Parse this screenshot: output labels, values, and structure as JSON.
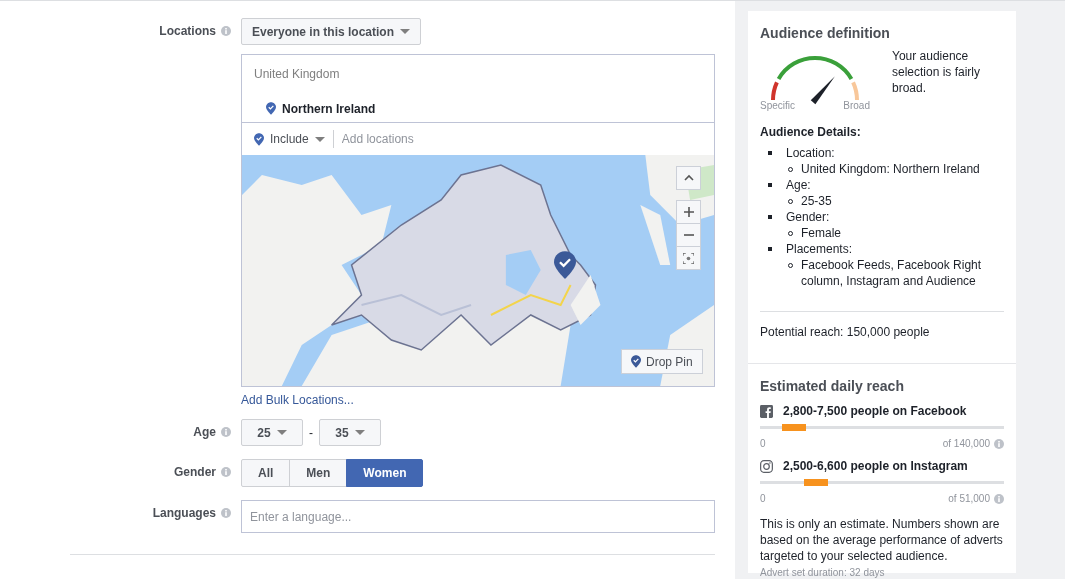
{
  "form": {
    "locations": {
      "label": "Locations",
      "mode": "Everyone in this location",
      "country": "United Kingdom",
      "selected_location": "Northern Ireland",
      "include": "Include",
      "add_placeholder": "Add locations",
      "map": {
        "kind": "picture",
        "drop_pin": "Drop Pin"
      },
      "bulk_link": "Add Bulk Locations..."
    },
    "age": {
      "label": "Age",
      "min": "25",
      "separator": "-",
      "max": "35"
    },
    "gender": {
      "label": "Gender",
      "options": [
        {
          "label": "All",
          "selected": false
        },
        {
          "label": "Men",
          "selected": false
        },
        {
          "label": "Women",
          "selected": true
        }
      ]
    },
    "languages": {
      "label": "Languages",
      "placeholder": "Enter a language..."
    }
  },
  "audience_definition": {
    "title": "Audience definition",
    "gauge": {
      "low_label": "Specific",
      "high_label": "Broad"
    },
    "summary": "Your audience selection is fairly broad.",
    "details_title": "Audience Details:",
    "details": [
      {
        "label": "Location:",
        "values": [
          "United Kingdom: Northern Ireland"
        ]
      },
      {
        "label": "Age:",
        "values": [
          "25-35"
        ]
      },
      {
        "label": "Gender:",
        "values": [
          "Female"
        ]
      },
      {
        "label": "Placements:",
        "values": [
          "Facebook Feeds, Facebook Right column, Instagram and Audience"
        ]
      }
    ],
    "potential_reach": "Potential reach: 150,000 people"
  },
  "estimated_daily_reach": {
    "title": "Estimated daily reach",
    "platforms": [
      {
        "kind": "facebook",
        "text": "2,800-7,500 people on Facebook",
        "level": 0.14,
        "min": "0",
        "max": "of 140,000"
      },
      {
        "kind": "instagram",
        "text": "2,500-6,600 people on Instagram",
        "level": 0.23,
        "min": "0",
        "max": "of 51,000"
      }
    ],
    "note": "This is only an estimate. Numbers shown are based on the average performance of adverts targeted to your selected audience.",
    "duration": "Advert set duration: 32 days"
  }
}
